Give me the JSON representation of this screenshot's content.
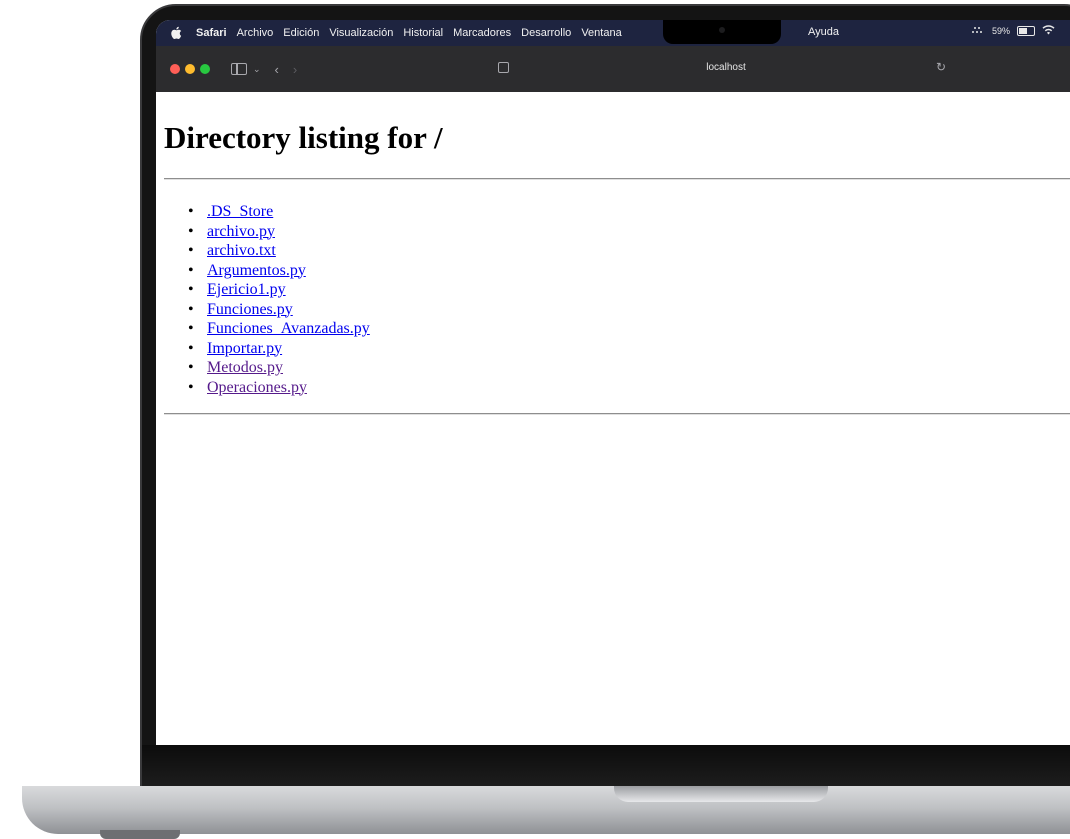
{
  "menubar": {
    "app": "Safari",
    "items": [
      "Archivo",
      "Edición",
      "Visualización",
      "Historial",
      "Marcadores",
      "Desarrollo",
      "Ventana"
    ],
    "help": "Ayuda",
    "battery": "59%"
  },
  "toolbar": {
    "url": "localhost"
  },
  "page": {
    "title": "Directory listing for /",
    "files": [
      {
        "name": ".DS_Store",
        "visited": false
      },
      {
        "name": "archivo.py",
        "visited": false
      },
      {
        "name": "archivo.txt",
        "visited": false
      },
      {
        "name": "Argumentos.py",
        "visited": false
      },
      {
        "name": "Ejericio1.py",
        "visited": false
      },
      {
        "name": "Funciones.py",
        "visited": false
      },
      {
        "name": "Funciones_Avanzadas.py",
        "visited": false
      },
      {
        "name": "Importar.py",
        "visited": false
      },
      {
        "name": "Metodos.py",
        "visited": true
      },
      {
        "name": "Operaciones.py",
        "visited": true
      }
    ]
  },
  "icons": {
    "apple": "apple-icon",
    "wifi": "wifi-icon",
    "battery": "battery-icon",
    "reload": "reload-icon",
    "sidebar": "sidebar-icon"
  },
  "colors": {
    "link": "#0000ee",
    "visited_link": "#551a8b",
    "menubar": "#1e2440",
    "toolbar": "#2c2c2e",
    "close": "#ff5f57",
    "minimize": "#febc2e",
    "zoom": "#28c840"
  }
}
